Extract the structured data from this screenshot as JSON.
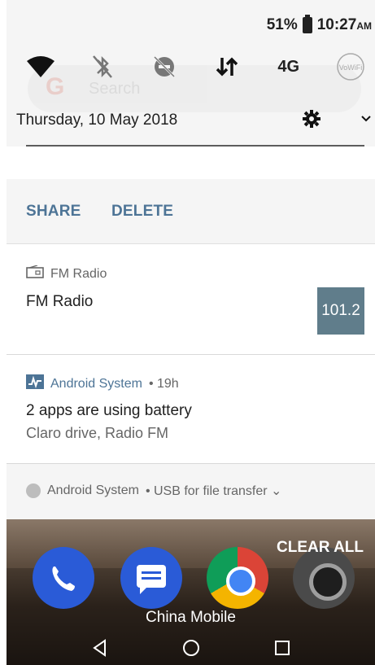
{
  "status_bar": {
    "battery_percent": "51%",
    "time": "10:27",
    "time_suffix": "AM"
  },
  "quick_settings": {
    "tiles": [
      {
        "icon": "wifi-icon"
      },
      {
        "icon": "bluetooth-off-icon"
      },
      {
        "icon": "do-not-disturb-off-icon"
      },
      {
        "icon": "data-arrows-icon"
      },
      {
        "icon": "network-4g",
        "label": "4G"
      },
      {
        "icon": "vowifi-icon",
        "label": "VoWiFi"
      }
    ],
    "date": "Thursday, 10 May 2018",
    "settings_icon": "gear-icon",
    "expand_icon": "chevron-down-icon"
  },
  "notification_actions": {
    "share_label": "SHARE",
    "delete_label": "DELETE"
  },
  "notifications": [
    {
      "app": "FM Radio",
      "title": "FM Radio",
      "frequency": "101.2"
    },
    {
      "app": "Android System",
      "time": "• 19h",
      "title": "2 apps are using battery",
      "text": "Claro drive, Radio FM"
    },
    {
      "app": "Android System",
      "summary": "• USB for file transfer ⌄"
    }
  ],
  "home": {
    "clear_all_label": "CLEAR ALL",
    "carrier": "China Mobile"
  },
  "colors": {
    "accent": "#4d7496",
    "frequency_box": "#607d8b",
    "panel_gray": "#f5f5f5"
  }
}
